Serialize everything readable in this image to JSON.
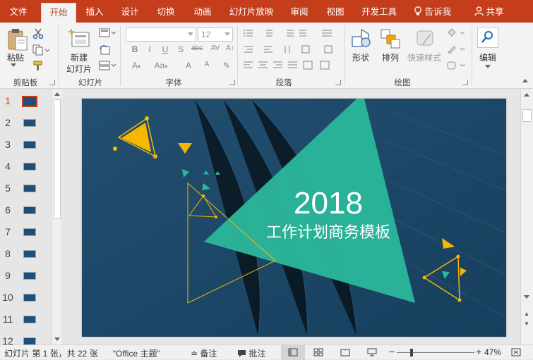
{
  "tabs": {
    "file": "文件",
    "home": "开始",
    "insert": "插入",
    "design": "设计",
    "transitions": "切换",
    "animations": "动画",
    "slideshow": "幻灯片放映",
    "review": "审阅",
    "view": "视图",
    "developer": "开发工具",
    "tell_me": "告诉我",
    "share": "共享"
  },
  "ribbon": {
    "clipboard": {
      "paste": "粘贴",
      "group_label": "剪贴板"
    },
    "slides": {
      "new_slide_line1": "新建",
      "new_slide_line2": "幻灯片",
      "group_label": "幻灯片"
    },
    "font": {
      "font_size": "12",
      "group_label": "字体"
    },
    "paragraph": {
      "group_label": "段落"
    },
    "drawing": {
      "shapes": "形状",
      "arrange": "排列",
      "quick_styles": "快速样式",
      "group_label": "绘图"
    },
    "editing": {
      "label": "编辑"
    }
  },
  "thumbnails": [
    "1",
    "2",
    "3",
    "4",
    "5",
    "6",
    "7",
    "8",
    "9",
    "10",
    "11",
    "12"
  ],
  "slide": {
    "year": "2018",
    "subtitle": "工作计划商务模板"
  },
  "status": {
    "slide_info": "幻灯片 第 1 张，共 22 张",
    "theme": "“Office 主题”",
    "notes": "备注",
    "comments": "批注",
    "zoom": "47%"
  },
  "colors": {
    "accent_red": "#c43e1c",
    "slide_bg": "#1e4d6e",
    "teal": "#2bb89c",
    "yellow": "#f5b800"
  }
}
